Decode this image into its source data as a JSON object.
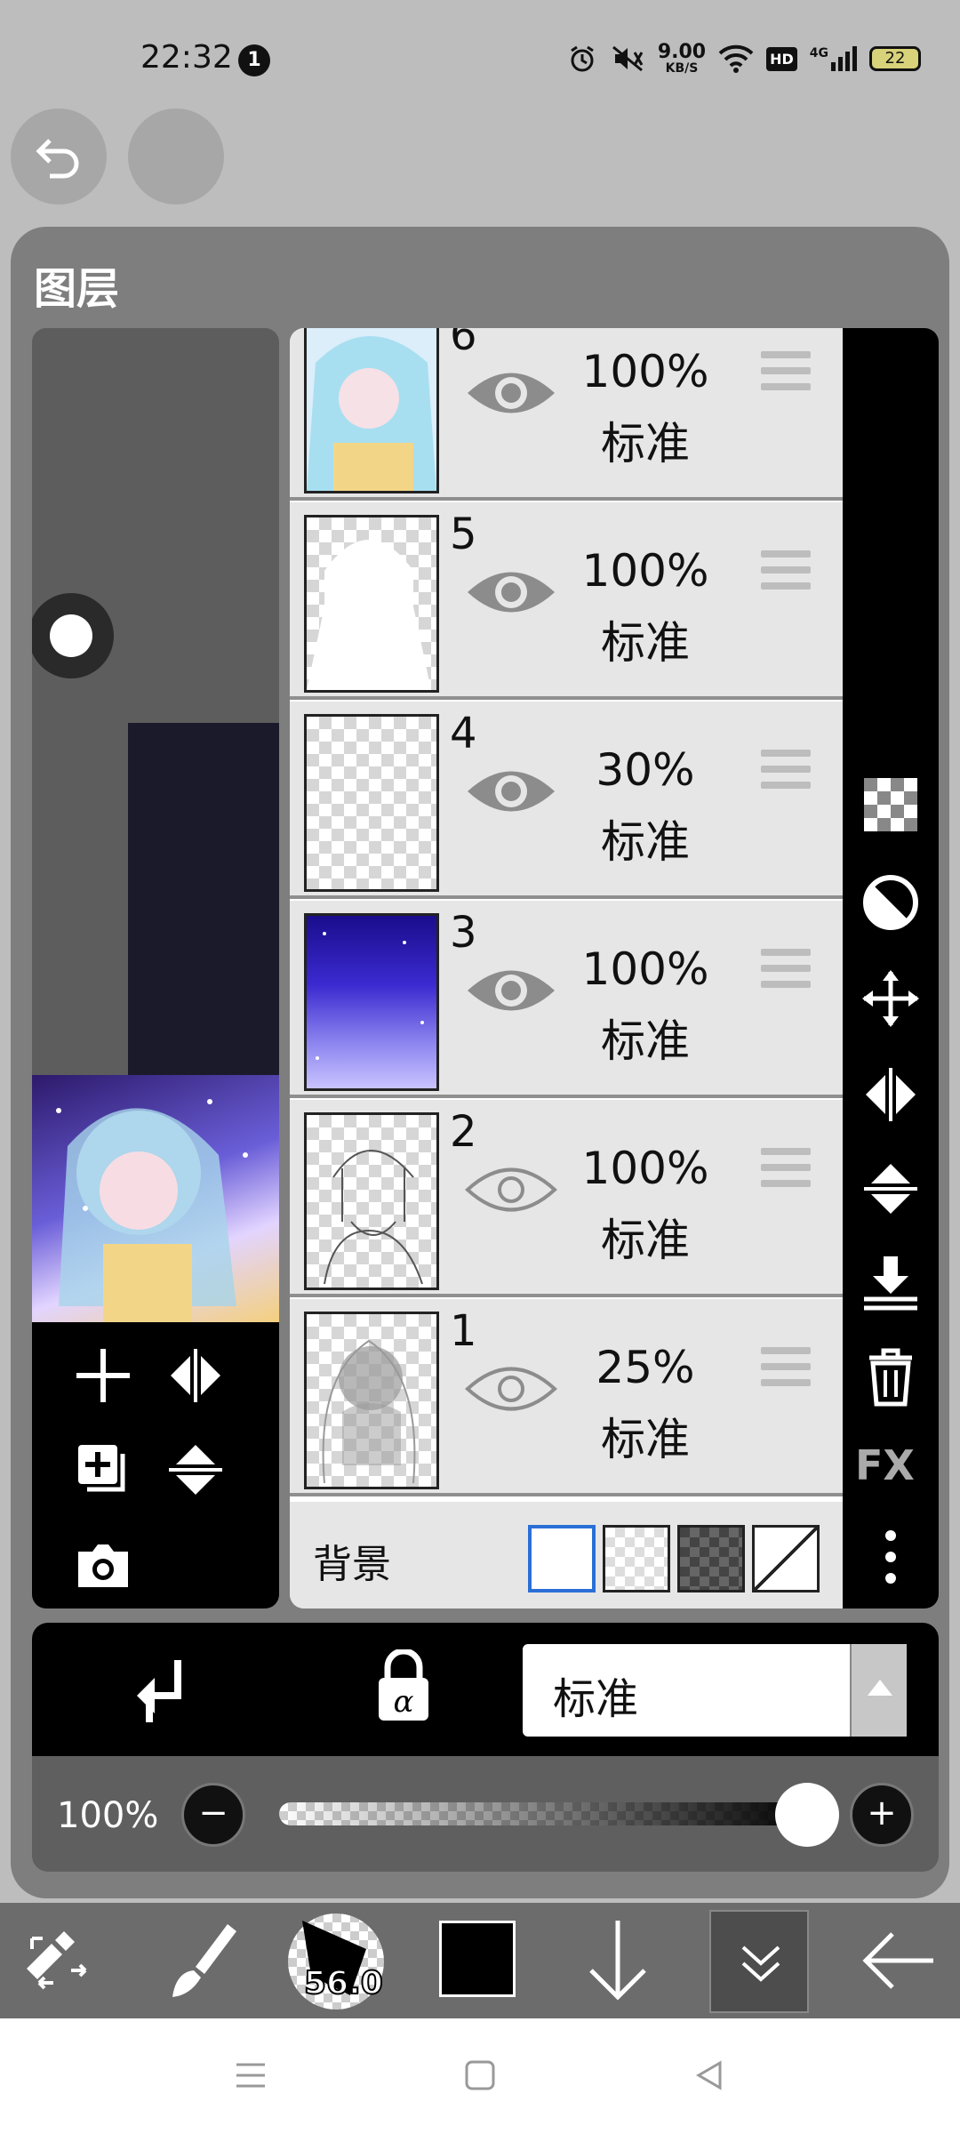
{
  "status_bar": {
    "time": "22:32",
    "notification_count": "1",
    "speed_value": "9.00",
    "speed_unit": "KB/S",
    "hd_label": "HD",
    "signal_label": "4G",
    "battery": "22"
  },
  "panel": {
    "title": "图层"
  },
  "layers": [
    {
      "number": "6",
      "opacity": "100%",
      "mode": "标准"
    },
    {
      "number": "5",
      "opacity": "100%",
      "mode": "标准"
    },
    {
      "number": "4",
      "opacity": "30%",
      "mode": "标准"
    },
    {
      "number": "3",
      "opacity": "100%",
      "mode": "标准"
    },
    {
      "number": "2",
      "opacity": "100%",
      "mode": "标准"
    },
    {
      "number": "1",
      "opacity": "25%",
      "mode": "标准"
    }
  ],
  "background": {
    "label": "背景"
  },
  "tools": {
    "fx_label": "FX"
  },
  "blend": {
    "selected": "标准"
  },
  "opacity": {
    "label": "100%",
    "value": 1.0
  },
  "bottom_toolbar": {
    "brush_size": "56.0",
    "color": "#000000"
  }
}
